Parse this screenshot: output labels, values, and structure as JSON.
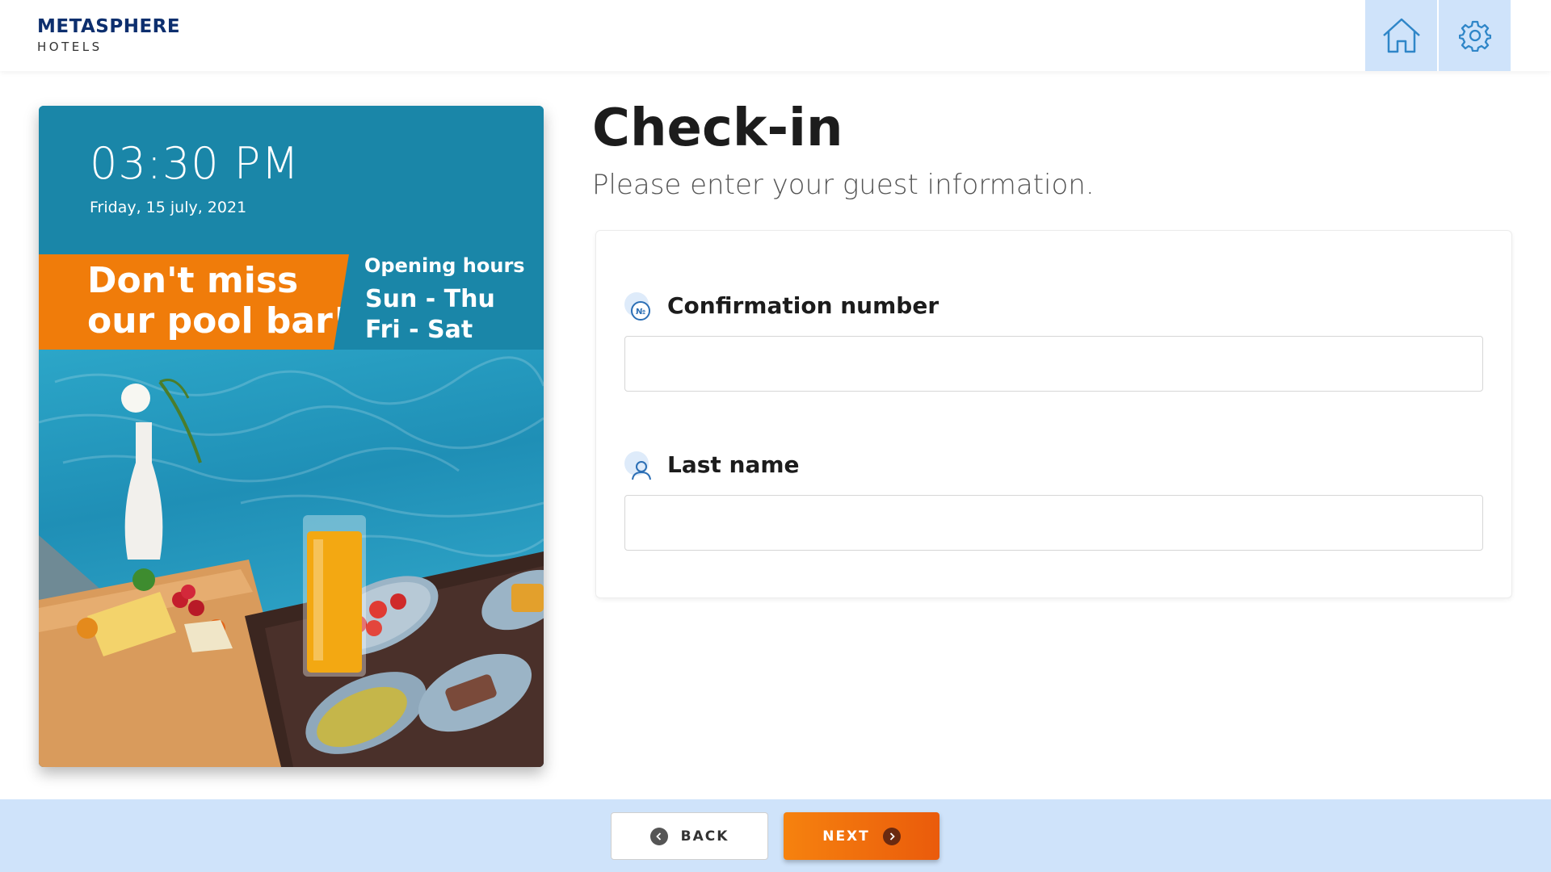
{
  "brand": {
    "name": "METASPHERE",
    "sub": "HOTELS"
  },
  "header": {
    "home_icon": "home-icon",
    "settings_icon": "gear-icon"
  },
  "promo": {
    "time": "03:30 PM",
    "date": "Friday, 15 july, 2021",
    "banner_line1": "Don't miss",
    "banner_line2": "our pool bar!",
    "hours_title": "Opening hours",
    "hours": [
      "Sun - Thu",
      "Fri - Sat"
    ]
  },
  "page": {
    "title": "Check-in",
    "subtitle": "Please enter your guest information."
  },
  "form": {
    "confirmation_label": "Confirmation number",
    "confirmation_value": "",
    "confirmation_icon": "number-sign-icon",
    "lastname_label": "Last name",
    "lastname_value": "",
    "lastname_icon": "person-icon"
  },
  "footer": {
    "back_label": "BACK",
    "next_label": "NEXT"
  },
  "colors": {
    "brand": "#0d2f6e",
    "accent": "#f07c0a",
    "header_button_bg": "#cfe3fa",
    "promo_bg": "#1a86a8"
  }
}
